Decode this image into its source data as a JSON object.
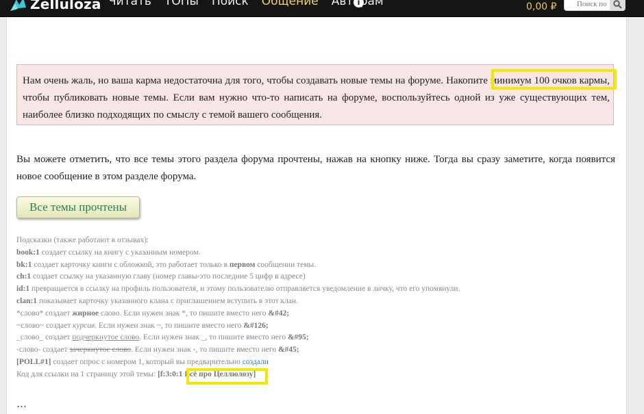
{
  "nav": {
    "logo_text": "Zelluloza",
    "links": [
      {
        "label": "Читать",
        "active": false
      },
      {
        "label": "ТОПы",
        "active": false
      },
      {
        "label": "Поиск",
        "active": false
      },
      {
        "label": "Общение",
        "active": true
      },
      {
        "label": "Авторам",
        "active": false
      }
    ],
    "info_glyph": "i",
    "balance": "0,00 ₽",
    "search_placeholder": "Поиск по"
  },
  "alert": {
    "text": "Нам очень жаль, но ваша карма недостаточна для того, чтобы создавать новые темы на форуме. Накопите минимум 100 очков кармы, чтобы публиковать новые темы. Если вам нужно что-то написать на форуме, воспользуйтесь одной из уже существующих тем, наиболее близко подходящих по смыслу с темой вашего сообщения."
  },
  "mark_all": {
    "description": "Вы можете отметить, что все темы этого раздела форума прочтены, нажав на кнопку ниже. Тогда вы сразу заметите, когда появится новое сообщение в этом разделе форума.",
    "button_label": "Все темы прочтены"
  },
  "hints": {
    "title": "Подсказки (также работают в отзывах):",
    "book_code": "book:1",
    "book_text": " создает ссылку на книгу с указанным номером.",
    "bk_code": "bk:1",
    "bk_text": " создает карточку книги с обложкой, это работает только в ",
    "bk_bold": "первом",
    "bk_tail": " сообщении темы.",
    "ch_code": "ch:1",
    "ch_text": " создает ссылку на указанную главу (номер главы-это последние 5 цифр в адресе)",
    "id_code": "id:1",
    "id_text": " превращается в ссылку на профиль пользователя, и этому пользователю отправляется уведомление в личку, что его упомянули.",
    "clan_code": "clan:1",
    "clan_text": " показывает карточку указанного клана с приглашением вступить в этот клан.",
    "bold_pre": "*слово* создает ",
    "bold_word": "жирное",
    "bold_mid": " слово. Если нужен знак *, то пишите вместо него ",
    "bold_code": "&#42;",
    "italic_pre": "~слово~ создает ",
    "italic_word": "курсив",
    "italic_mid": ". Если нужен знак ~, то пишите вместо него ",
    "italic_code": "&#126;",
    "under_pre": "_слово_ создает ",
    "under_word": "подчеркнутое слово",
    "under_mid": ". Если нужен знак _, то пишите вместо него ",
    "under_code": "&#95;",
    "strike_pre": "-слово- создает ",
    "strike_word": "зачеркнутое слово",
    "strike_mid": ". Если нужен знак -, то пишите вместо него ",
    "strike_code": "&#45;",
    "poll_code": "[POLL#1]",
    "poll_text": " создает опрос с номером 1, который вы предварительно ",
    "poll_link": "создали",
    "link_pre": "Код для ссылки на 1 страницу этой темы: ",
    "link_code": "[f:3:0:1 Всё про Целлюлозу]"
  },
  "bottom_text": "…"
}
